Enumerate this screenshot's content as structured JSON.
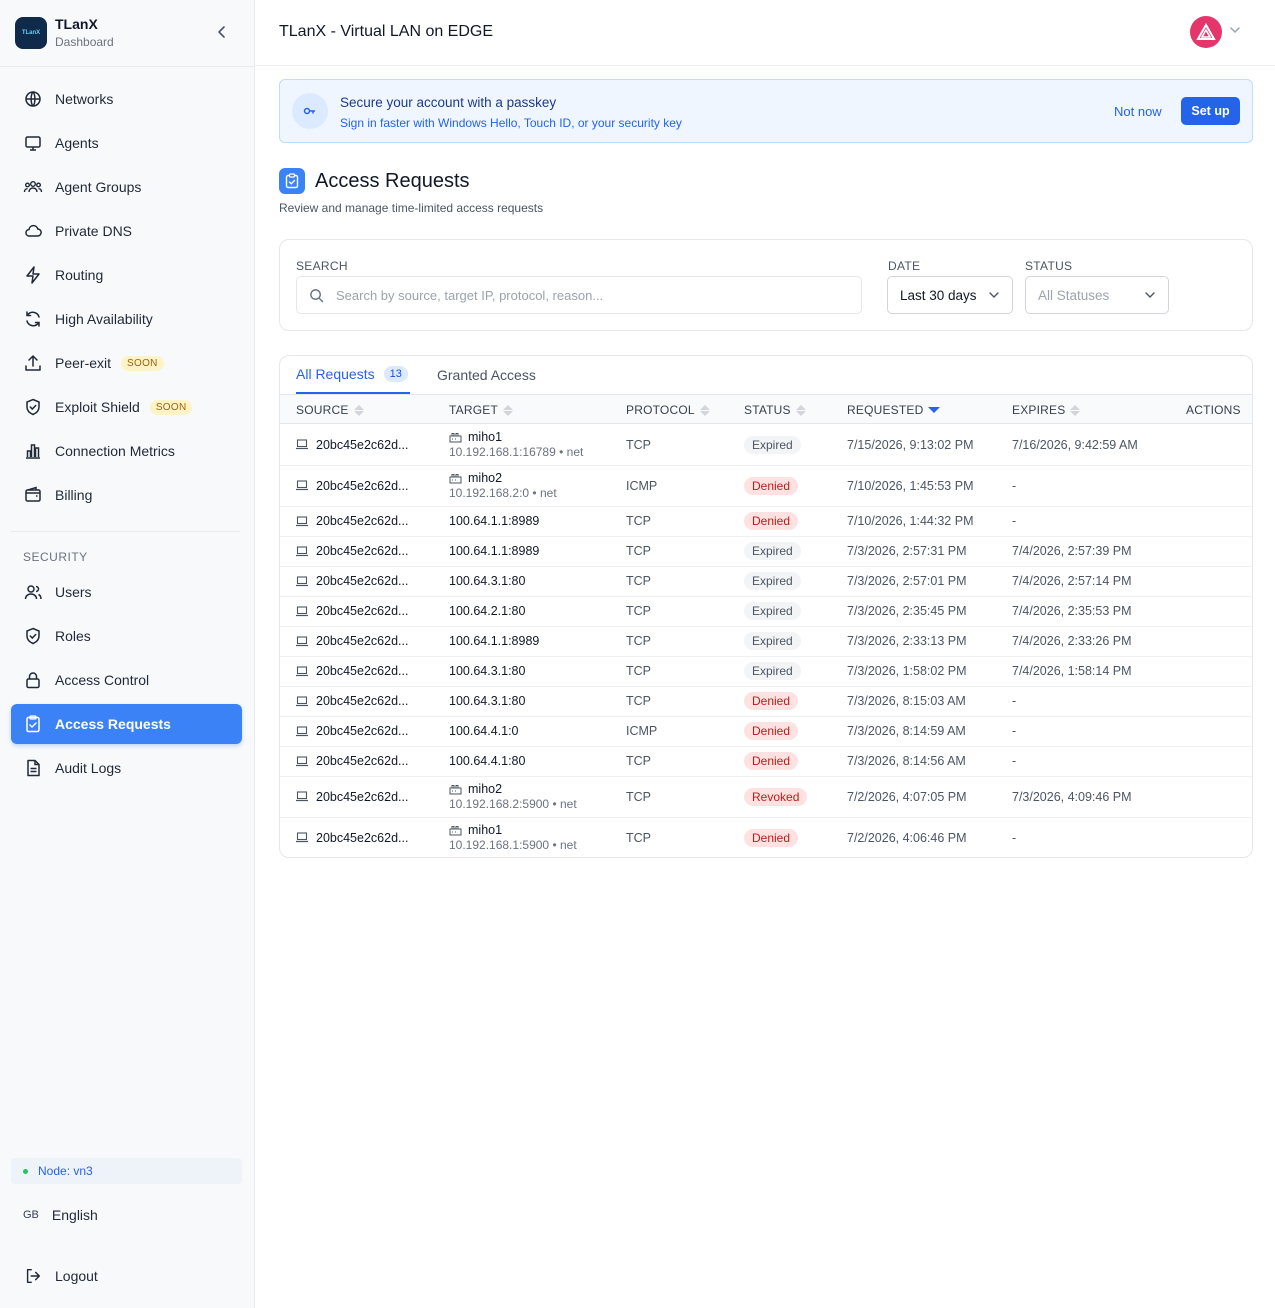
{
  "brand": {
    "name": "TLanX",
    "subtitle": "Dashboard",
    "logo_text": "TLanX"
  },
  "sidebar": {
    "items": [
      {
        "label": "Networks",
        "icon": "globe-icon"
      },
      {
        "label": "Agents",
        "icon": "monitor-icon"
      },
      {
        "label": "Agent Groups",
        "icon": "users-group-icon"
      },
      {
        "label": "Private DNS",
        "icon": "cloud-icon"
      },
      {
        "label": "Routing",
        "icon": "bolt-icon"
      },
      {
        "label": "High Availability",
        "icon": "refresh-icon"
      },
      {
        "label": "Peer-exit",
        "icon": "upload-icon",
        "badge": "SOON"
      },
      {
        "label": "Exploit Shield",
        "icon": "shield-check-icon",
        "badge": "SOON"
      },
      {
        "label": "Connection Metrics",
        "icon": "bar-chart-icon"
      },
      {
        "label": "Billing",
        "icon": "wallet-icon"
      }
    ],
    "security_label": "SECURITY",
    "security_items": [
      {
        "label": "Users",
        "icon": "users-icon"
      },
      {
        "label": "Roles",
        "icon": "shield-check-icon"
      },
      {
        "label": "Access Control",
        "icon": "lock-icon"
      },
      {
        "label": "Access Requests",
        "icon": "clipboard-check-icon",
        "active": true
      },
      {
        "label": "Audit Logs",
        "icon": "document-icon"
      }
    ],
    "node": "Node: vn3",
    "language_code": "GB",
    "language": "English",
    "logout": "Logout"
  },
  "header": {
    "title": "TLanX - Virtual LAN on EDGE"
  },
  "banner": {
    "title": "Secure your account with a passkey",
    "subtitle": "Sign in faster with Windows Hello, Touch ID, or your security key",
    "not_now": "Not now",
    "setup": "Set up"
  },
  "page": {
    "title": "Access Requests",
    "subtitle": "Review and manage time-limited access requests"
  },
  "filters": {
    "search_label": "SEARCH",
    "search_placeholder": "Search by source, target IP, protocol, reason...",
    "date_label": "DATE",
    "date_value": "Last 30 days",
    "status_label": "STATUS",
    "status_value": "All Statuses"
  },
  "tabs": [
    {
      "label": "All Requests",
      "count": "13",
      "active": true
    },
    {
      "label": "Granted Access"
    }
  ],
  "columns": [
    "SOURCE",
    "TARGET",
    "PROTOCOL",
    "STATUS",
    "REQUESTED",
    "EXPIRES",
    "ACTIONS"
  ],
  "rows": [
    {
      "source": "20bc45e2c62d...",
      "target_name": "miho1",
      "target_addr": "10.192.168.1:16789",
      "target_net": "net",
      "protocol": "TCP",
      "status": "Expired",
      "requested": "7/15/2026, 9:13:02 PM",
      "expires": "7/16/2026, 9:42:59 AM"
    },
    {
      "source": "20bc45e2c62d...",
      "target_name": "miho2",
      "target_addr": "10.192.168.2:0",
      "target_net": "net",
      "protocol": "ICMP",
      "status": "Denied",
      "requested": "7/10/2026, 1:45:53 PM",
      "expires": "-"
    },
    {
      "source": "20bc45e2c62d...",
      "target": "100.64.1.1:8989",
      "protocol": "TCP",
      "status": "Denied",
      "requested": "7/10/2026, 1:44:32 PM",
      "expires": "-"
    },
    {
      "source": "20bc45e2c62d...",
      "target": "100.64.1.1:8989",
      "protocol": "TCP",
      "status": "Expired",
      "requested": "7/3/2026, 2:57:31 PM",
      "expires": "7/4/2026, 2:57:39 PM"
    },
    {
      "source": "20bc45e2c62d...",
      "target": "100.64.3.1:80",
      "protocol": "TCP",
      "status": "Expired",
      "requested": "7/3/2026, 2:57:01 PM",
      "expires": "7/4/2026, 2:57:14 PM"
    },
    {
      "source": "20bc45e2c62d...",
      "target": "100.64.2.1:80",
      "protocol": "TCP",
      "status": "Expired",
      "requested": "7/3/2026, 2:35:45 PM",
      "expires": "7/4/2026, 2:35:53 PM"
    },
    {
      "source": "20bc45e2c62d...",
      "target": "100.64.1.1:8989",
      "protocol": "TCP",
      "status": "Expired",
      "requested": "7/3/2026, 2:33:13 PM",
      "expires": "7/4/2026, 2:33:26 PM"
    },
    {
      "source": "20bc45e2c62d...",
      "target": "100.64.3.1:80",
      "protocol": "TCP",
      "status": "Expired",
      "requested": "7/3/2026, 1:58:02 PM",
      "expires": "7/4/2026, 1:58:14 PM"
    },
    {
      "source": "20bc45e2c62d...",
      "target": "100.64.3.1:80",
      "protocol": "TCP",
      "status": "Denied",
      "requested": "7/3/2026, 8:15:03 AM",
      "expires": "-"
    },
    {
      "source": "20bc45e2c62d...",
      "target": "100.64.4.1:0",
      "protocol": "ICMP",
      "status": "Denied",
      "requested": "7/3/2026, 8:14:59 AM",
      "expires": "-"
    },
    {
      "source": "20bc45e2c62d...",
      "target": "100.64.4.1:80",
      "protocol": "TCP",
      "status": "Denied",
      "requested": "7/3/2026, 8:14:56 AM",
      "expires": "-"
    },
    {
      "source": "20bc45e2c62d...",
      "target_name": "miho2",
      "target_addr": "10.192.168.2:5900",
      "target_net": "net",
      "protocol": "TCP",
      "status": "Revoked",
      "requested": "7/2/2026, 4:07:05 PM",
      "expires": "7/3/2026, 4:09:46 PM"
    },
    {
      "source": "20bc45e2c62d...",
      "target_name": "miho1",
      "target_addr": "10.192.168.1:5900",
      "target_net": "net",
      "protocol": "TCP",
      "status": "Denied",
      "requested": "7/2/2026, 4:06:46 PM",
      "expires": "-"
    }
  ]
}
